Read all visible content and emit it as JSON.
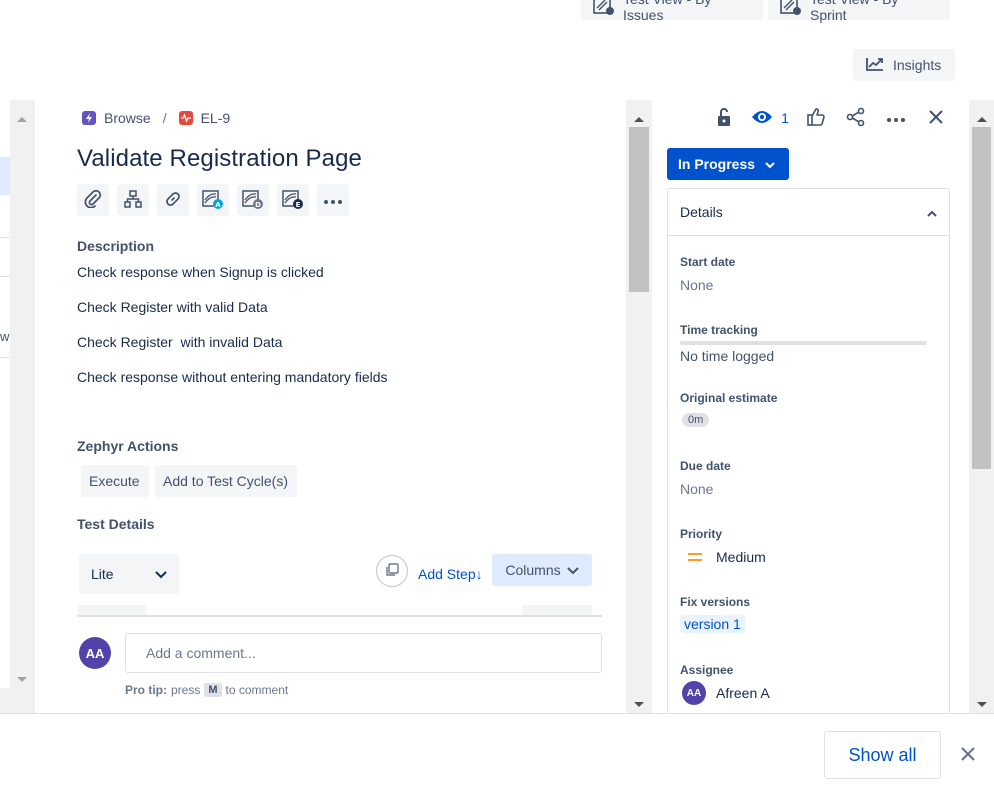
{
  "top_buttons": {
    "test_view_issues": "Test View - By Issues",
    "test_view_sprint": "Test View - By Sprint",
    "insights": "Insights"
  },
  "left_panel": {
    "partial_text": "wo"
  },
  "breadcrumb": {
    "project": "Browse",
    "separator": "/",
    "issue_key": "EL-9"
  },
  "issue": {
    "title": "Validate Registration Page",
    "description_heading": "Description",
    "description_lines": [
      "Check response when Signup is clicked",
      "Check Register with valid Data",
      "Check Register  with invalid Data",
      "Check response without entering mandatory fields"
    ]
  },
  "toolbar_icons": {
    "attach": "paperclip-icon",
    "child": "hierarchy-icon",
    "link": "link-icon",
    "app_a_badge": "A",
    "app_d_badge": "D",
    "app_e_badge": "E",
    "more": "more-icon"
  },
  "zephyr": {
    "heading": "Zephyr Actions",
    "execute": "Execute",
    "add_to_cycle": "Add to Test Cycle(s)"
  },
  "test_details": {
    "heading": "Test Details",
    "mode": "Lite",
    "add_step": "Add Step↓",
    "columns": "Columns"
  },
  "comment": {
    "avatar_initials": "AA",
    "placeholder": "Add a comment...",
    "pro_tip_label": "Pro tip:",
    "pro_tip_press": "press",
    "pro_tip_key": "M",
    "pro_tip_suffix": "to comment"
  },
  "right_panel": {
    "watch_count": "1",
    "status": "In Progress",
    "details_title": "Details",
    "fields": {
      "start_date_label": "Start date",
      "start_date_value": "None",
      "time_tracking_label": "Time tracking",
      "time_tracking_value": "No time logged",
      "time_tracking_progress": 0,
      "original_estimate_label": "Original estimate",
      "original_estimate_value": "0m",
      "due_date_label": "Due date",
      "due_date_value": "None",
      "priority_label": "Priority",
      "priority_value": "Medium",
      "fix_versions_label": "Fix versions",
      "fix_versions_value": "version 1",
      "assignee_label": "Assignee",
      "assignee_initials": "AA",
      "assignee_name": "Afreen A"
    }
  },
  "bottom_bar": {
    "show_all": "Show all"
  },
  "colors": {
    "primary": "#0052cc",
    "avatar": "#5243aa",
    "priority_medium": "#ff991f"
  }
}
